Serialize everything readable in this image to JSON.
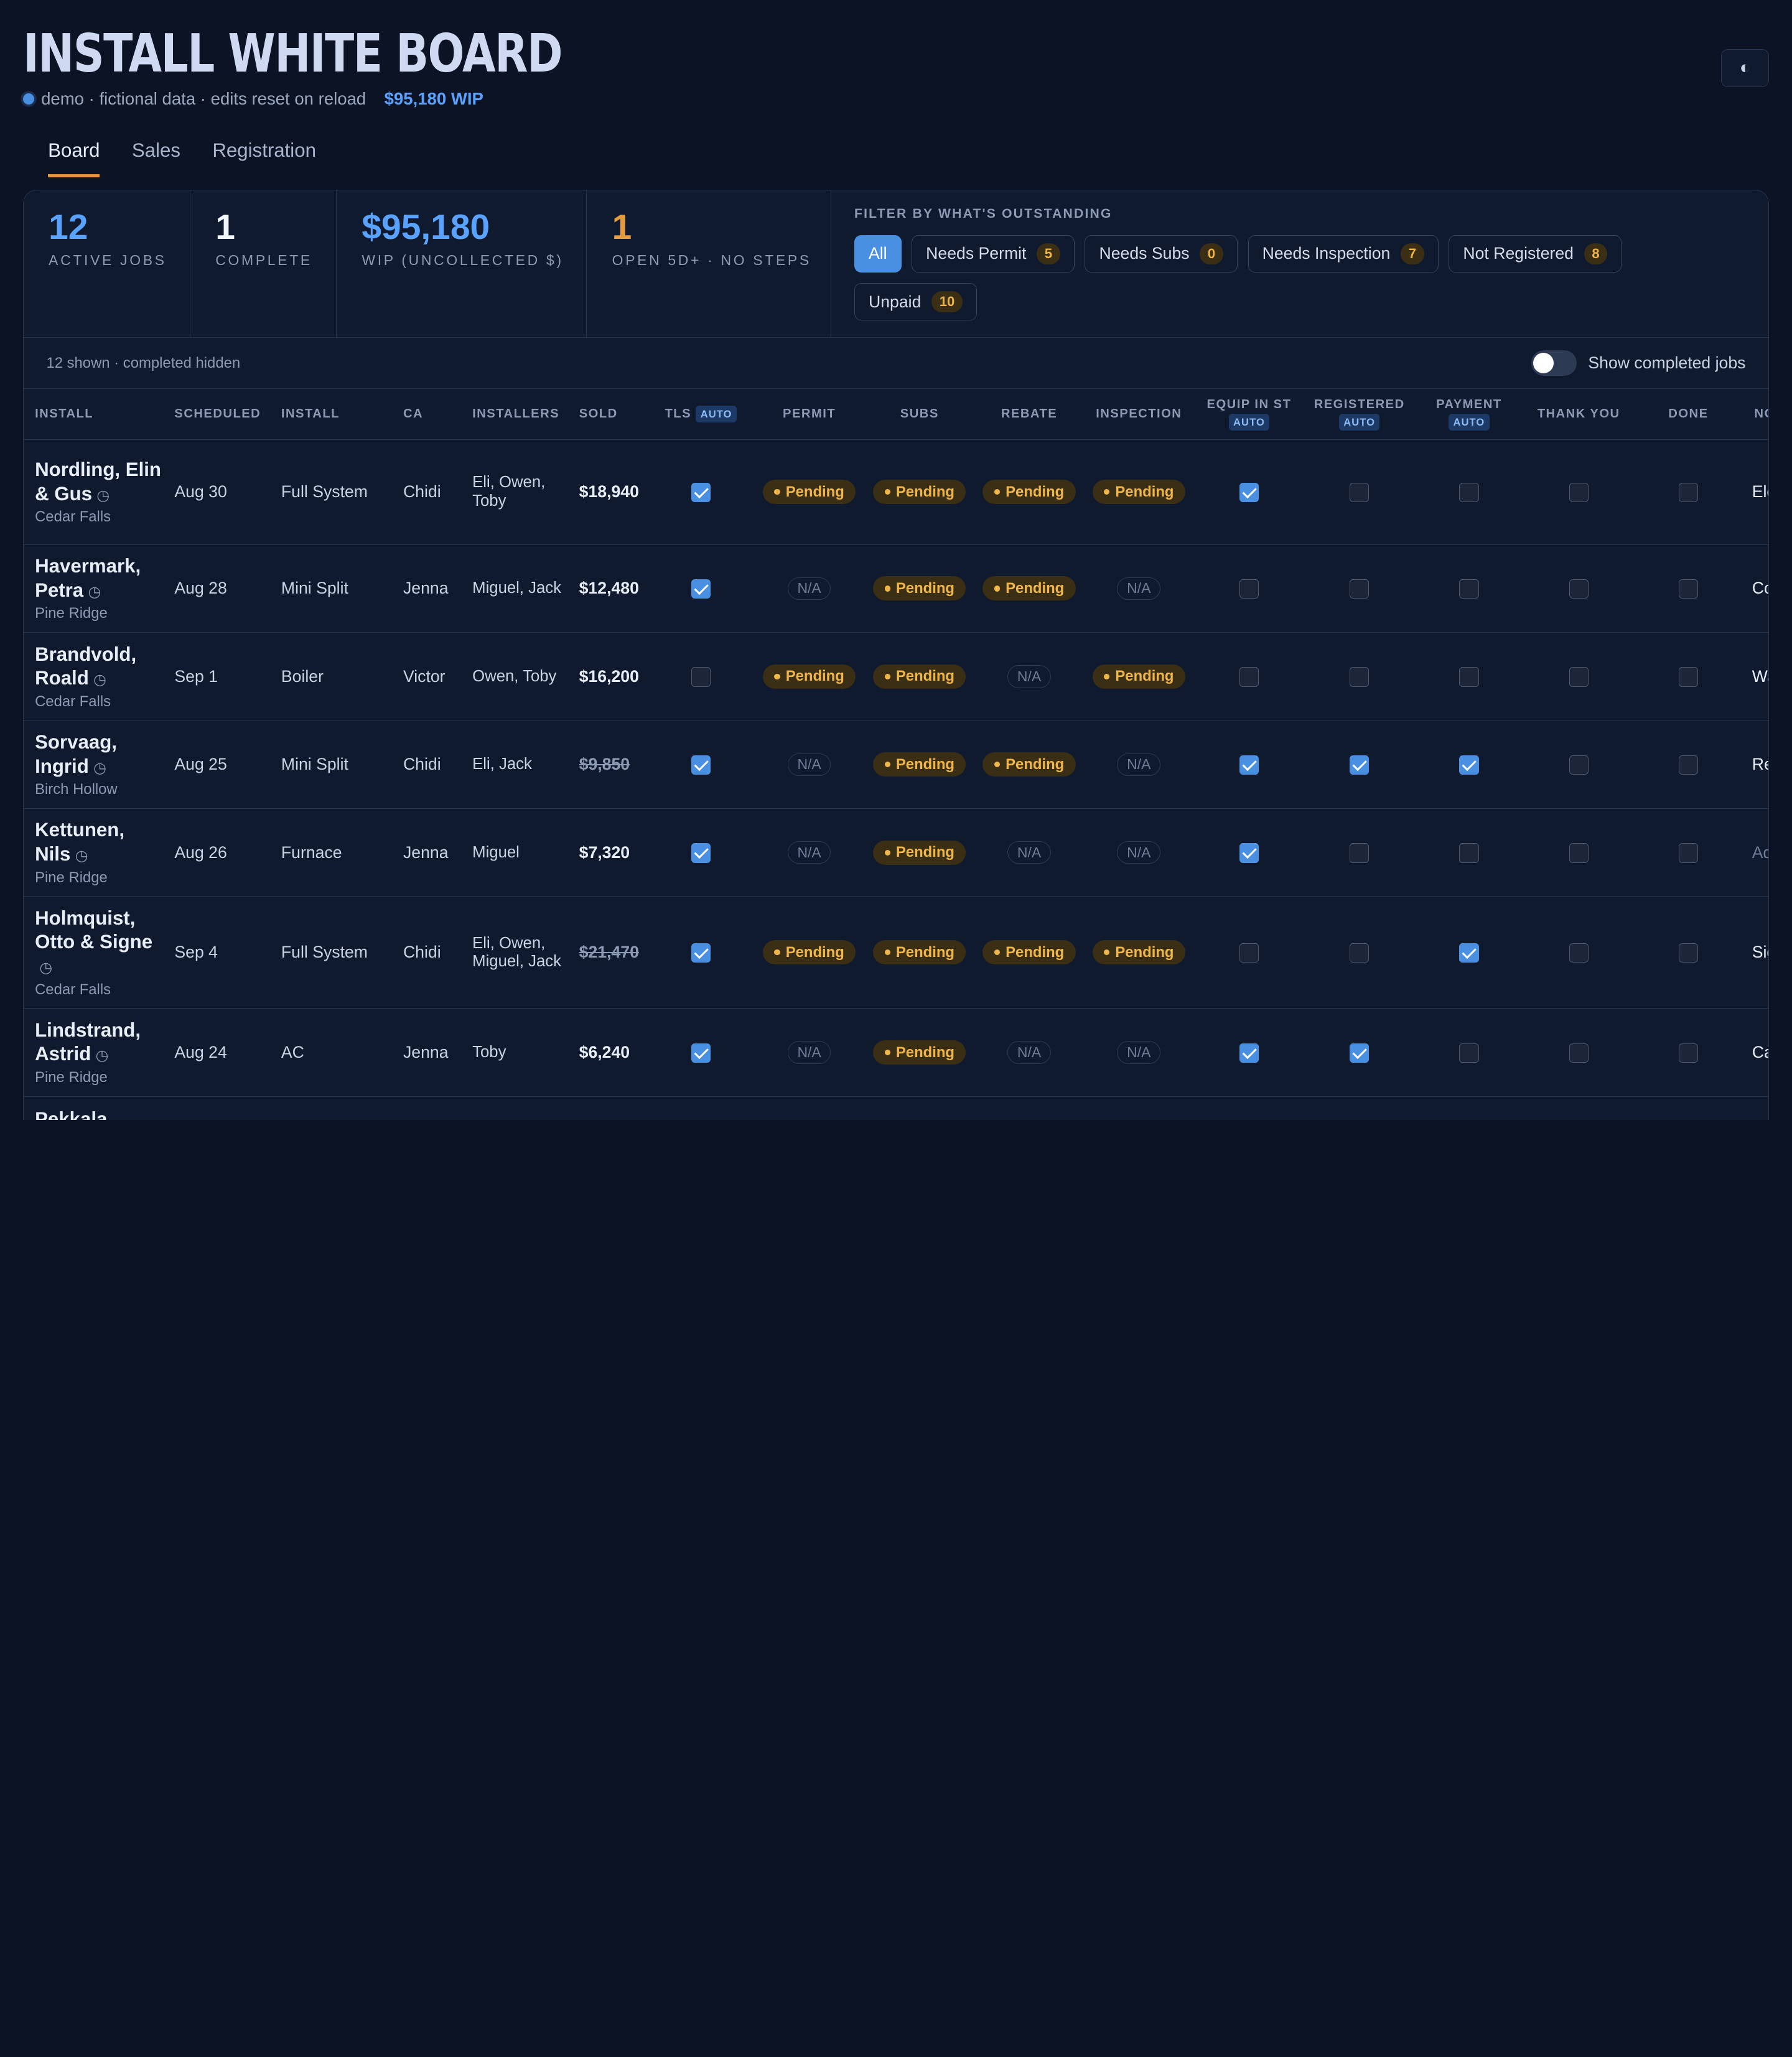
{
  "header": {
    "title": "INSTALL WHITE BOARD",
    "subtitle": "demo · fictional data · edits reset on reload",
    "wip_link": "$95,180 WIP",
    "theme_icon": "◐"
  },
  "tabs": [
    {
      "label": "Board",
      "active": true
    },
    {
      "label": "Sales",
      "active": false
    },
    {
      "label": "Registration",
      "active": false
    }
  ],
  "stats": [
    {
      "value": "12",
      "label": "ACTIVE JOBS",
      "color": "#5aa2ff"
    },
    {
      "value": "1",
      "label": "COMPLETE",
      "color": "#f0f4fb"
    },
    {
      "value": "$95,180",
      "label": "WIP (UNCOLLECTED $)",
      "color": "#5aa2ff"
    },
    {
      "value": "1",
      "label": "OPEN 5D+ · NO STEPS",
      "color": "#e59b3f"
    }
  ],
  "filter": {
    "title": "FILTER BY WHAT'S OUTSTANDING",
    "chips": [
      {
        "label": "All",
        "count": "",
        "active": true
      },
      {
        "label": "Needs Permit",
        "count": "5"
      },
      {
        "label": "Needs Subs",
        "count": "0"
      },
      {
        "label": "Needs Inspection",
        "count": "7"
      },
      {
        "label": "Not Registered",
        "count": "8"
      },
      {
        "label": "Unpaid",
        "count": "10"
      }
    ]
  },
  "toolbar": {
    "shown_text": "12 shown · completed hidden",
    "toggle_label": "Show completed jobs",
    "toggle_on": false
  },
  "columns": {
    "install": "INSTALL",
    "scheduled": "SCHEDULED",
    "install_type": "INSTALL",
    "ca": "CA",
    "installers": "INSTALLERS",
    "sold": "SOLD",
    "tls": "TLS",
    "permit": "PERMIT",
    "subs": "SUBS",
    "rebate": "REBATE",
    "inspection": "INSPECTION",
    "equip": "EQUIP IN ST",
    "registered": "REGISTERED",
    "payment": "PAYMENT",
    "thank_you": "THANK YOU",
    "done": "DONE",
    "notes": "NOTES",
    "auto_tag": "AUTO"
  },
  "rows": [
    {
      "name": "Nordling, Elin & Gus",
      "city": "Cedar Falls",
      "scheduled": "Aug 30",
      "install": "Full System",
      "ca": "Chidi",
      "installers": "Eli, Owen, Toby",
      "sold": "$18,940",
      "sold_struck": false,
      "tls": true,
      "permit": "Pending",
      "subs": "Pending",
      "rebate": "Pending",
      "inspection": "Pending",
      "equip": true,
      "registered": false,
      "payment": false,
      "thank_you": false,
      "done": false,
      "notes": "Elect"
    },
    {
      "name": "Havermark, Petra",
      "city": "Pine Ridge",
      "scheduled": "Aug 28",
      "install": "Mini Split",
      "ca": "Jenna",
      "installers": "Miguel, Jack",
      "sold": "$12,480",
      "sold_struck": false,
      "tls": true,
      "permit": "N/A",
      "subs": "Pending",
      "rebate": "Pending",
      "inspection": "N/A",
      "equip": false,
      "registered": false,
      "payment": false,
      "thank_you": false,
      "done": false,
      "notes": "Conc"
    },
    {
      "name": "Brandvold, Roald",
      "city": "Cedar Falls",
      "scheduled": "Sep 1",
      "install": "Boiler",
      "ca": "Victor",
      "installers": "Owen, Toby",
      "sold": "$16,200",
      "sold_struck": false,
      "tls": false,
      "permit": "Pending",
      "subs": "Pending",
      "rebate": "N/A",
      "inspection": "Pending",
      "equip": false,
      "registered": false,
      "payment": false,
      "thank_you": false,
      "done": false,
      "notes": "Waiti"
    },
    {
      "name": "Sorvaag, Ingrid",
      "city": "Birch Hollow",
      "scheduled": "Aug 25",
      "install": "Mini Split",
      "ca": "Chidi",
      "installers": "Eli, Jack",
      "sold": "$9,850",
      "sold_struck": true,
      "tls": true,
      "permit": "N/A",
      "subs": "Pending",
      "rebate": "Pending",
      "inspection": "N/A",
      "equip": true,
      "registered": true,
      "payment": true,
      "thank_you": false,
      "done": false,
      "notes": "Reba"
    },
    {
      "name": "Kettunen, Nils",
      "city": "Pine Ridge",
      "scheduled": "Aug 26",
      "install": "Furnace",
      "ca": "Jenna",
      "installers": "Miguel",
      "sold": "$7,320",
      "sold_struck": false,
      "tls": true,
      "permit": "N/A",
      "subs": "Pending",
      "rebate": "N/A",
      "inspection": "N/A",
      "equip": true,
      "registered": false,
      "payment": false,
      "thank_you": false,
      "done": false,
      "notes": "Add a",
      "notes_muted": true
    },
    {
      "name": "Holmquist, Otto & Signe",
      "city": "Cedar Falls",
      "scheduled": "Sep 4",
      "install": "Full System",
      "ca": "Chidi",
      "installers": "Eli, Owen, Miguel, Jack",
      "sold": "$21,470",
      "sold_struck": true,
      "tls": true,
      "permit": "Pending",
      "subs": "Pending",
      "rebate": "Pending",
      "inspection": "Pending",
      "equip": false,
      "registered": false,
      "payment": true,
      "thank_you": false,
      "done": false,
      "notes": "Signe"
    },
    {
      "name": "Lindstrand, Astrid",
      "city": "Pine Ridge",
      "scheduled": "Aug 24",
      "install": "AC",
      "ca": "Jenna",
      "installers": "Toby",
      "sold": "$6,240",
      "sold_struck": false,
      "tls": true,
      "permit": "N/A",
      "subs": "Pending",
      "rebate": "N/A",
      "inspection": "N/A",
      "equip": true,
      "registered": true,
      "payment": false,
      "thank_you": false,
      "done": false,
      "notes": "Callb"
    },
    {
      "name": "Pekkala,",
      "city": "",
      "scheduled": "",
      "install": "",
      "ca": "",
      "installers": "",
      "sold": "",
      "sold_struck": false,
      "tls": null,
      "permit": "",
      "subs": "",
      "rebate": "",
      "inspection": "",
      "equip": null,
      "registered": null,
      "payment": null,
      "thank_you": null,
      "done": null,
      "notes": ""
    }
  ]
}
